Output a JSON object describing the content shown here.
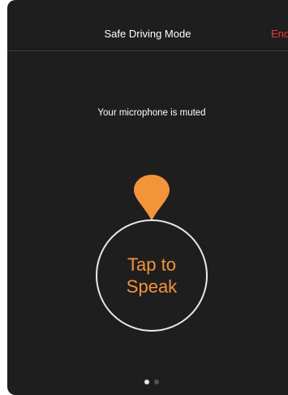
{
  "nav": {
    "title": "Safe Driving Mode",
    "end_label": "End"
  },
  "status": {
    "message": "Your microphone is muted"
  },
  "speak_button": {
    "label": "Tap to Speak"
  },
  "pagination": {
    "total": 2,
    "active": 1
  },
  "colors": {
    "background": "#1e1e1e",
    "accent_orange": "#f3943a",
    "end_red": "#e63a37",
    "text": "#ffffff"
  },
  "icons": {
    "pin": "location-pin-icon"
  }
}
